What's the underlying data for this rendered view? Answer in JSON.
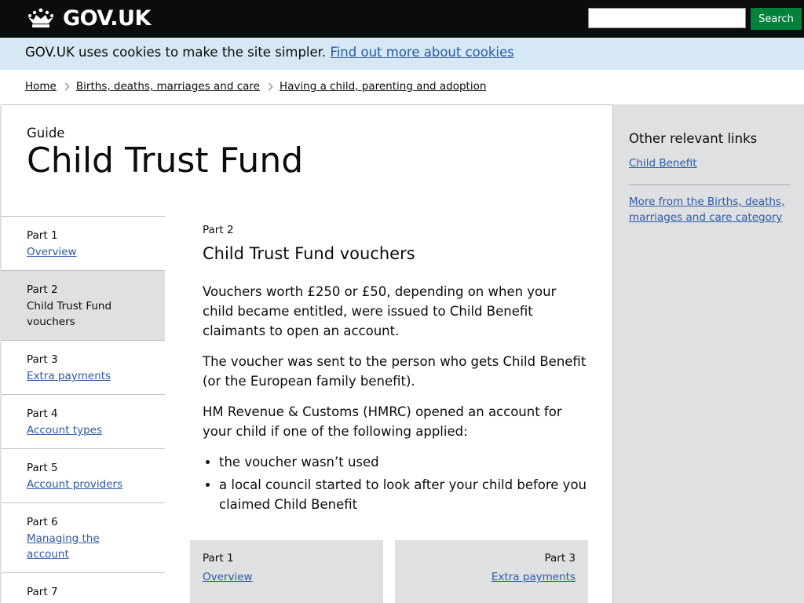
{
  "header": {
    "logo_text": "GOV.UK",
    "search": {
      "value": "",
      "placeholder": ""
    },
    "search_button_label": "Search"
  },
  "cookie_banner": {
    "text": "GOV.UK uses cookies to make the site simpler.",
    "link_label": "Find out more about cookies"
  },
  "breadcrumbs": [
    {
      "label": "Home"
    },
    {
      "label": "Births, deaths, marriages and care"
    },
    {
      "label": "Having a child, parenting and adoption"
    }
  ],
  "guide": {
    "label": "Guide",
    "title": "Child Trust Fund"
  },
  "parts_nav": [
    {
      "part": "Part 1",
      "label": "Overview",
      "current": false
    },
    {
      "part": "Part 2",
      "label": "Child Trust Fund vouchers",
      "current": true
    },
    {
      "part": "Part 3",
      "label": "Extra payments",
      "current": false
    },
    {
      "part": "Part 4",
      "label": "Account types",
      "current": false
    },
    {
      "part": "Part 5",
      "label": "Account providers",
      "current": false
    },
    {
      "part": "Part 6",
      "label": "Managing the account",
      "current": false
    },
    {
      "part": "Part 7",
      "label": "",
      "current": false
    }
  ],
  "content": {
    "part": "Part 2",
    "title": "Child Trust Fund vouchers",
    "paragraphs": [
      "Vouchers worth £250 or £50, depending on when your child became entitled, were issued to Child Benefit claimants to open an account.",
      "The voucher was sent to the person who gets Child Benefit (or the European family benefit).",
      "HM Revenue & Customs (HMRC) opened an account for your child if one of the following applied:"
    ],
    "bullets": [
      "the voucher wasn’t used",
      "a local council started to look after your child before you claimed Child Benefit"
    ]
  },
  "pager": {
    "previous": {
      "part": "Part 1",
      "label": "Overview"
    },
    "next": {
      "part": "Part 3",
      "label": "Extra payments"
    }
  },
  "related": {
    "title": "Other relevant links",
    "link1": "Child Benefit",
    "link2": "More from the Births, deaths, marriages and care category"
  },
  "colors": {
    "header_bg": "#0b0c0c",
    "search_button_bg": "#00823b",
    "cookie_banner_bg": "#d5e8f3",
    "link": "#2b5aa6",
    "panel_grey": "#dee0e2"
  },
  "icons": {
    "logo": "crown-icon",
    "breadcrumb_separator": "chevron-right-icon"
  }
}
